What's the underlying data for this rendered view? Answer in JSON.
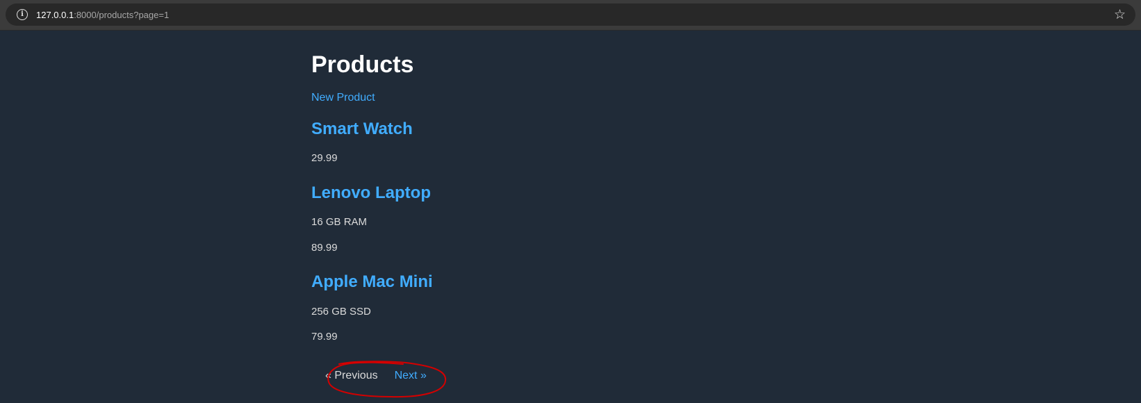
{
  "browser": {
    "url_host": "127.0.0.1",
    "url_path": ":8000/products?page=1"
  },
  "page": {
    "title": "Products",
    "new_product_label": "New Product"
  },
  "products": [
    {
      "name": "Smart Watch",
      "description": "",
      "price": "29.99"
    },
    {
      "name": "Lenovo Laptop",
      "description": "16 GB RAM",
      "price": "89.99"
    },
    {
      "name": "Apple Mac Mini",
      "description": "256 GB SSD",
      "price": "79.99"
    }
  ],
  "pagination": {
    "previous_label": "« Previous",
    "next_label": "Next »"
  },
  "colors": {
    "background": "#202b38",
    "link": "#41adff",
    "annotation": "#d40000"
  }
}
